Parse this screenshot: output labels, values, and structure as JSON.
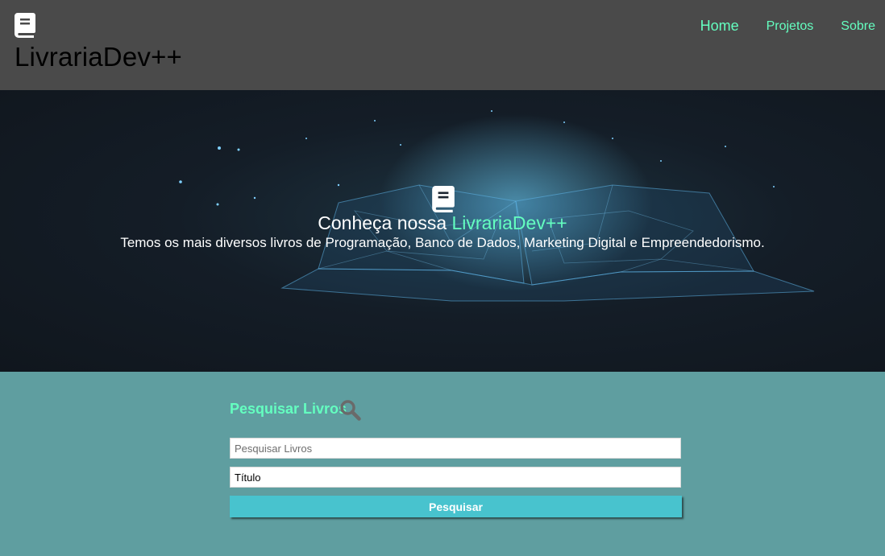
{
  "header": {
    "brand": "LivrariaDev++",
    "logo_icon": "book-icon",
    "nav": [
      {
        "label": "Home"
      },
      {
        "label": "Projetos"
      },
      {
        "label": "Sobre"
      }
    ]
  },
  "hero": {
    "icon": "book-icon",
    "title_prefix": "Conheça nossa ",
    "title_accent": "LivrariaDev++",
    "subtitle": "Temos os mais diversos livros de Programação, Banco de Dados, Marketing Digital e Empreendedorismo."
  },
  "search": {
    "title": "Pesquisar Livros",
    "icon": "search-icon",
    "query_placeholder": "Pesquisar Livros",
    "type_value": "Título",
    "button_label": "Pesquisar"
  },
  "colors": {
    "header_bg": "#4a4a4a",
    "accent": "#64ffc0",
    "section_bg": "#5f9ea0",
    "button_bg": "#48c3ce"
  }
}
